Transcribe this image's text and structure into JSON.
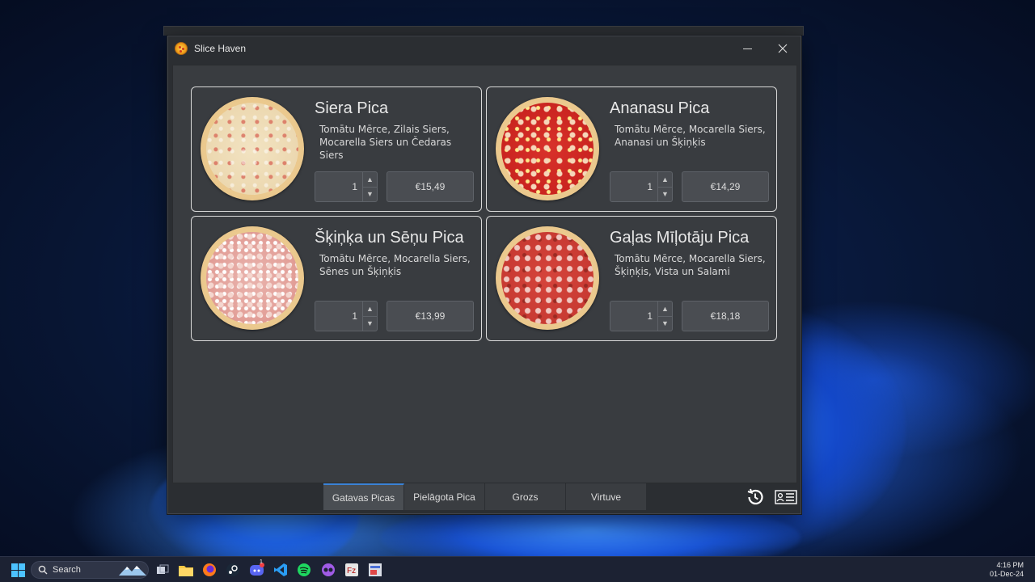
{
  "window": {
    "title": "Slice Haven"
  },
  "pizzas": [
    {
      "name": "Siera Pica",
      "description": "Tomātu Mērce, Zilais Siers, Mocarella Siers un Čedaras Siers",
      "quantity": "1",
      "price": "€15,49",
      "image": "cheese"
    },
    {
      "name": "Ananasu Pica",
      "description": "Tomātu Mērce, Mocarella Siers, Ananasi un Šķiņķis",
      "quantity": "1",
      "price": "€14,29",
      "image": "pineapple"
    },
    {
      "name": "Šķiņķa un Sēņu Pica",
      "description": "Tomātu Mērce, Mocarella Siers, Sēnes un Šķiņķis",
      "quantity": "1",
      "price": "€13,99",
      "image": "ham"
    },
    {
      "name": "Gaļas Mīļotāju Pica",
      "description": "Tomātu Mērce, Mocarella Siers, Šķiņķis, Vista un Salami",
      "quantity": "1",
      "price": "€18,18",
      "image": "meat"
    }
  ],
  "tabs": [
    {
      "label": "Gatavas Picas",
      "active": true
    },
    {
      "label": "Pielāgota Pica",
      "active": false
    },
    {
      "label": "Grozs",
      "active": false
    },
    {
      "label": "Virtuve",
      "active": false
    }
  ],
  "bottom_icons": [
    "history-icon",
    "profile-list-icon"
  ],
  "taskbar": {
    "search_placeholder": "Search",
    "time": "4:16 PM",
    "date": "01-Dec-24",
    "discord_badge": "1",
    "pinned_icons": [
      "file-explorer-icon",
      "folder-icon",
      "firefox-icon",
      "steam-icon",
      "discord-icon",
      "vscode-icon",
      "spotify-icon",
      "obs-icon",
      "filezilla-icon",
      "app-icon"
    ]
  },
  "colors": {
    "accent": "#3b82d6",
    "window_bg": "#2b2e32",
    "content_bg": "#393c40",
    "card_border": "#d9d9d9"
  }
}
